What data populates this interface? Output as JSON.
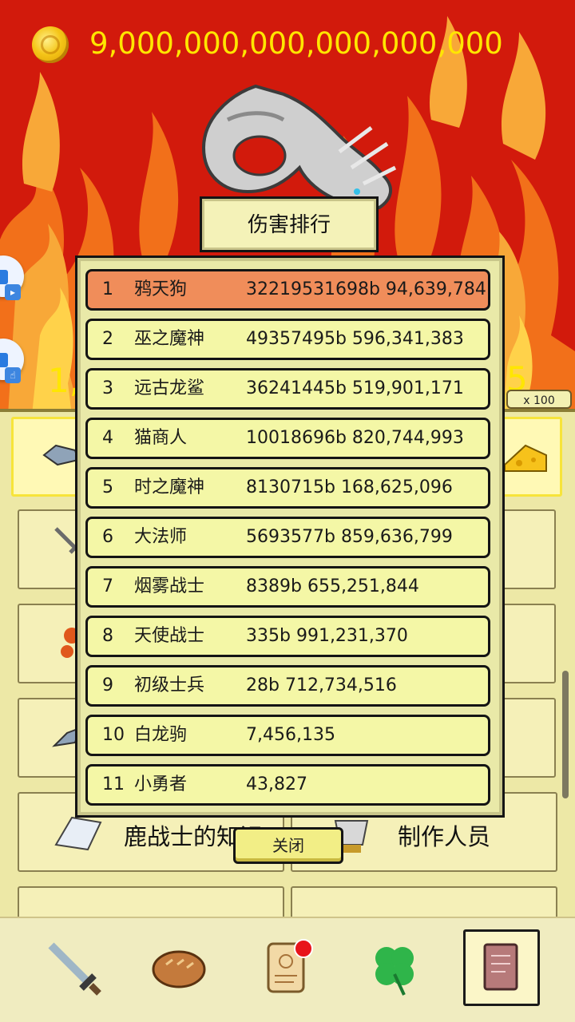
{
  "header": {
    "coin_amount": "9,000,000,000,000,000,000"
  },
  "background": {
    "peek_left": "1,",
    "peek_right": "5",
    "multiplier": "x 100"
  },
  "shop": {
    "item_left_label": "鹿战士的知识",
    "item_right_label": "制作人员"
  },
  "leaderboard": {
    "title": "伤害排行",
    "close_label": "关闭",
    "rows": [
      {
        "rank": "1",
        "name": "鸦天狗",
        "score": "32219531698b 94,639,784"
      },
      {
        "rank": "2",
        "name": "巫之魔神",
        "score": "49357495b 596,341,383"
      },
      {
        "rank": "3",
        "name": "远古龙鲨",
        "score": "36241445b 519,901,171"
      },
      {
        "rank": "4",
        "name": "猫商人",
        "score": "10018696b 820,744,993"
      },
      {
        "rank": "5",
        "name": "时之魔神",
        "score": "8130715b 168,625,096"
      },
      {
        "rank": "6",
        "name": "大法师",
        "score": "5693577b 859,636,799"
      },
      {
        "rank": "7",
        "name": "烟雾战士",
        "score": "8389b 655,251,844"
      },
      {
        "rank": "8",
        "name": "天使战士",
        "score": "335b 991,231,370"
      },
      {
        "rank": "9",
        "name": "初级士兵",
        "score": "28b 712,734,516"
      },
      {
        "rank": "10",
        "name": "白龙驹",
        "score": "7,456,135"
      },
      {
        "rank": "11",
        "name": "小勇者",
        "score": "43,827"
      }
    ]
  },
  "nav": {
    "items": [
      {
        "icon": "sword-icon"
      },
      {
        "icon": "bread-icon"
      },
      {
        "icon": "scroll-icon"
      },
      {
        "icon": "clover-icon"
      },
      {
        "icon": "book-icon"
      }
    ]
  },
  "colors": {
    "coin_text": "#ffe600",
    "first_row": "#f08d5a",
    "row": "#f4f7a6",
    "badge": "#e8141b"
  }
}
